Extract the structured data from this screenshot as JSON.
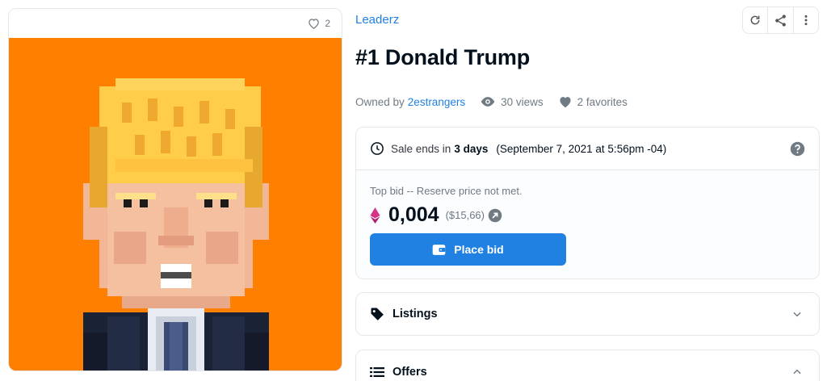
{
  "item": {
    "favorite_count": "2",
    "collection": "Leaderz",
    "title": "#1 Donald Trump",
    "owned_by_label": "Owned by",
    "owner": "2estrangers",
    "views": "30 views",
    "favorites": "2 favorites"
  },
  "icons": {
    "heart": "heart-icon",
    "refresh": "refresh-icon",
    "share": "share-icon",
    "more": "more-vertical-icon",
    "eye": "eye-icon",
    "clock": "clock-icon",
    "help": "help-icon",
    "eth": "ethereum-icon",
    "wallet": "wallet-icon",
    "tag": "tag-icon",
    "list": "list-icon"
  },
  "sale": {
    "ends_label": "Sale ends in",
    "ends_in": "3 days",
    "date": "(September 7, 2021 at 5:56pm -04)",
    "top_bid_label": "Top bid -- Reserve price not met.",
    "price": "0,004",
    "usd": "($15,66)",
    "bid_button": "Place bid"
  },
  "sections": {
    "listings": "Listings",
    "offers": "Offers"
  },
  "colors": {
    "accent": "#2081e2",
    "art_background": "#ff7f00",
    "ethereum": "#d63384"
  }
}
